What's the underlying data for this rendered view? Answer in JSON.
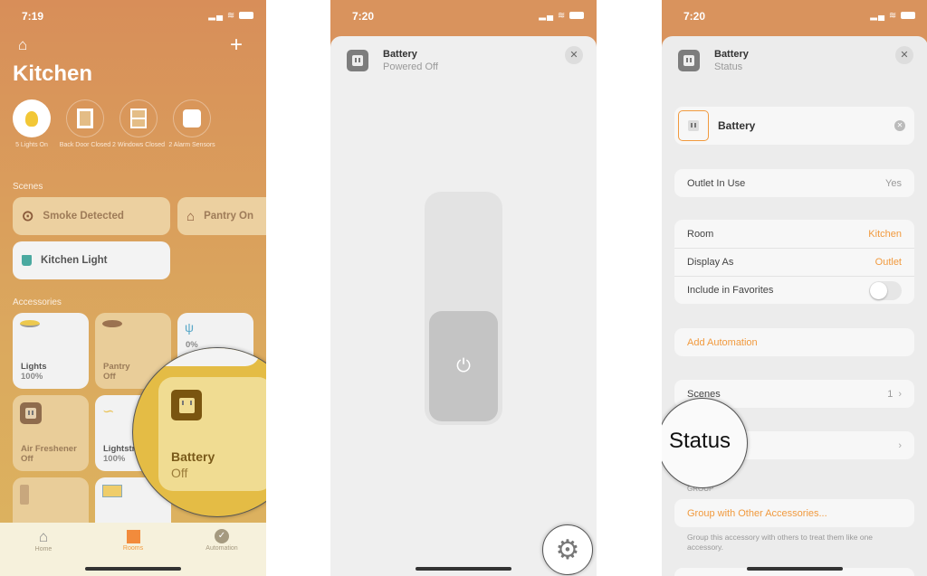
{
  "colors": {
    "accent": "#f19a3e",
    "home_bg": "#d88e59",
    "battery_tile": "#e8c24f"
  },
  "screen1": {
    "time": "7:19",
    "title": "Kitchen",
    "status": [
      {
        "label": "5 Lights On",
        "icon": "bulb-icon"
      },
      {
        "label": "Back Door Closed",
        "icon": "door-icon"
      },
      {
        "label": "2 Windows Closed",
        "icon": "window-icon"
      },
      {
        "label": "2 Alarm Sensors",
        "icon": "sensor-icon"
      }
    ],
    "scenes_header": "Scenes",
    "scenes": [
      {
        "label": "Smoke Detected",
        "icon": "smoke-icon"
      },
      {
        "label": "Pantry On",
        "icon": "house-icon"
      },
      {
        "label": "Kitchen Light",
        "icon": "mug-icon"
      }
    ],
    "accessories_header": "Accessories",
    "accessories": [
      {
        "name": "Lights",
        "state": "100%"
      },
      {
        "name": "Pantry",
        "state": "Off"
      },
      {
        "name": "",
        "state": "0%"
      },
      {
        "name": "Air Freshener",
        "state": "Off"
      },
      {
        "name": "Lightstrip",
        "state": "100%"
      },
      {
        "name": "",
        "state": ""
      },
      {
        "name": "",
        "state": ""
      }
    ],
    "magnified": {
      "name": "Battery",
      "state": "Off"
    },
    "tabs": [
      {
        "label": "Home"
      },
      {
        "label": "Rooms",
        "active": true
      },
      {
        "label": "Automation"
      }
    ]
  },
  "screen2": {
    "time": "7:20",
    "name": "Battery",
    "status": "Powered Off",
    "power_state": "off"
  },
  "screen3": {
    "time": "7:20",
    "name": "Battery",
    "status": "Status",
    "name_field": "Battery",
    "outlet_in_use": {
      "label": "Outlet In Use",
      "value": "Yes"
    },
    "room": {
      "label": "Room",
      "value": "Kitchen"
    },
    "display_as": {
      "label": "Display As",
      "value": "Outlet"
    },
    "favorites": {
      "label": "Include in Favorites",
      "on": false
    },
    "add_automation": "Add Automation",
    "scenes": {
      "label": "Scenes",
      "value": "1"
    },
    "group_header": "GROUP",
    "group_button": "Group with Other Accessories...",
    "group_footer": "Group this accessory with others to treat them like one accessory."
  }
}
